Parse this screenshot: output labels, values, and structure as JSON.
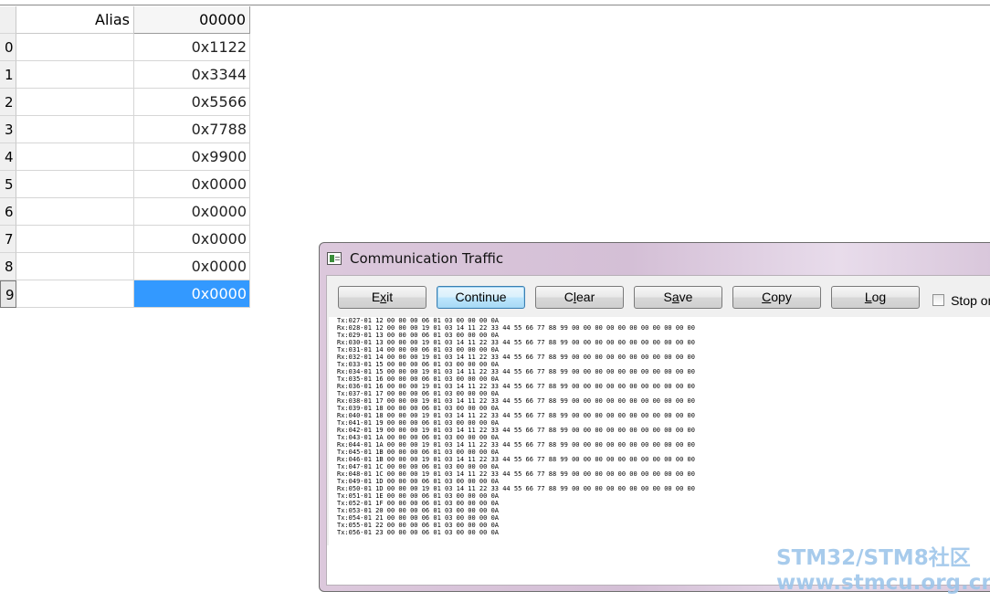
{
  "grid": {
    "columns": [
      "Alias",
      "00000"
    ],
    "rows": [
      {
        "index": "0",
        "alias": "",
        "value": "0x1122"
      },
      {
        "index": "1",
        "alias": "",
        "value": "0x3344"
      },
      {
        "index": "2",
        "alias": "",
        "value": "0x5566"
      },
      {
        "index": "3",
        "alias": "",
        "value": "0x7788"
      },
      {
        "index": "4",
        "alias": "",
        "value": "0x9900"
      },
      {
        "index": "5",
        "alias": "",
        "value": "0x0000"
      },
      {
        "index": "6",
        "alias": "",
        "value": "0x0000"
      },
      {
        "index": "7",
        "alias": "",
        "value": "0x0000"
      },
      {
        "index": "8",
        "alias": "",
        "value": "0x0000"
      },
      {
        "index": "9",
        "alias": "",
        "value": "0x0000"
      }
    ],
    "selected_row": "9"
  },
  "dialog": {
    "title": "Communication Traffic",
    "buttons": {
      "exit": {
        "label": "Exit",
        "mnemonic": "x"
      },
      "continue": {
        "label": "Continue"
      },
      "clear": {
        "label": "Clear",
        "mnemonic": "l"
      },
      "save": {
        "label": "Save",
        "mnemonic": "a"
      },
      "copy": {
        "label": "Copy",
        "mnemonic": "C"
      },
      "log": {
        "label": "Log",
        "mnemonic": "L"
      }
    },
    "stop_checkbox": {
      "label": "Stop on",
      "checked": false
    },
    "traffic_lines": [
      "Tx:027-01 12 00 00 00 06 01 03 00 00 00 0A",
      "Rx:028-01 12 00 00 00 19 01 03 14 11 22 33 44 55 66 77 88 99 00 00 00 00 00 00 00 00 00 00 00",
      "Tx:029-01 13 00 00 00 06 01 03 00 00 00 0A",
      "Rx:030-01 13 00 00 00 19 01 03 14 11 22 33 44 55 66 77 88 99 00 00 00 00 00 00 00 00 00 00 00",
      "Tx:031-01 14 00 00 00 06 01 03 00 00 00 0A",
      "Rx:032-01 14 00 00 00 19 01 03 14 11 22 33 44 55 66 77 88 99 00 00 00 00 00 00 00 00 00 00 00",
      "Tx:033-01 15 00 00 00 06 01 03 00 00 00 0A",
      "Rx:034-01 15 00 00 00 19 01 03 14 11 22 33 44 55 66 77 88 99 00 00 00 00 00 00 00 00 00 00 00",
      "Tx:035-01 16 00 00 00 06 01 03 00 00 00 0A",
      "Rx:036-01 16 00 00 00 19 01 03 14 11 22 33 44 55 66 77 88 99 00 00 00 00 00 00 00 00 00 00 00",
      "Tx:037-01 17 00 00 00 06 01 03 00 00 00 0A",
      "Rx:038-01 17 00 00 00 19 01 03 14 11 22 33 44 55 66 77 88 99 00 00 00 00 00 00 00 00 00 00 00",
      "Tx:039-01 18 00 00 00 06 01 03 00 00 00 0A",
      "Rx:040-01 18 00 00 00 19 01 03 14 11 22 33 44 55 66 77 88 99 00 00 00 00 00 00 00 00 00 00 00",
      "Tx:041-01 19 00 00 00 06 01 03 00 00 00 0A",
      "Rx:042-01 19 00 00 00 19 01 03 14 11 22 33 44 55 66 77 88 99 00 00 00 00 00 00 00 00 00 00 00",
      "Tx:043-01 1A 00 00 00 06 01 03 00 00 00 0A",
      "Rx:044-01 1A 00 00 00 19 01 03 14 11 22 33 44 55 66 77 88 99 00 00 00 00 00 00 00 00 00 00 00",
      "Tx:045-01 1B 00 00 00 06 01 03 00 00 00 0A",
      "Rx:046-01 1B 00 00 00 19 01 03 14 11 22 33 44 55 66 77 88 99 00 00 00 00 00 00 00 00 00 00 00",
      "Tx:047-01 1C 00 00 00 06 01 03 00 00 00 0A",
      "Rx:048-01 1C 00 00 00 19 01 03 14 11 22 33 44 55 66 77 88 99 00 00 00 00 00 00 00 00 00 00 00",
      "Tx:049-01 1D 00 00 00 06 01 03 00 00 00 0A",
      "Rx:050-01 1D 00 00 00 19 01 03 14 11 22 33 44 55 66 77 88 99 00 00 00 00 00 00 00 00 00 00 00",
      "Tx:051-01 1E 00 00 00 06 01 03 00 00 00 0A",
      "Tx:052-01 1F 00 00 00 06 01 03 00 00 00 0A",
      "Tx:053-01 20 00 00 00 06 01 03 00 00 00 0A",
      "Tx:054-01 21 00 00 00 06 01 03 00 00 00 0A",
      "Tx:055-01 22 00 00 00 06 01 03 00 00 00 0A",
      "Tx:056-01 23 00 00 00 06 01 03 00 00 00 0A"
    ]
  },
  "watermark": {
    "line1": "STM32/STM8社区",
    "line2": "www.stmcu.org.cn"
  },
  "colors": {
    "selection": "#3399ff",
    "title_bar": "#dcc8dc",
    "watermark": "#9ec6ea"
  }
}
